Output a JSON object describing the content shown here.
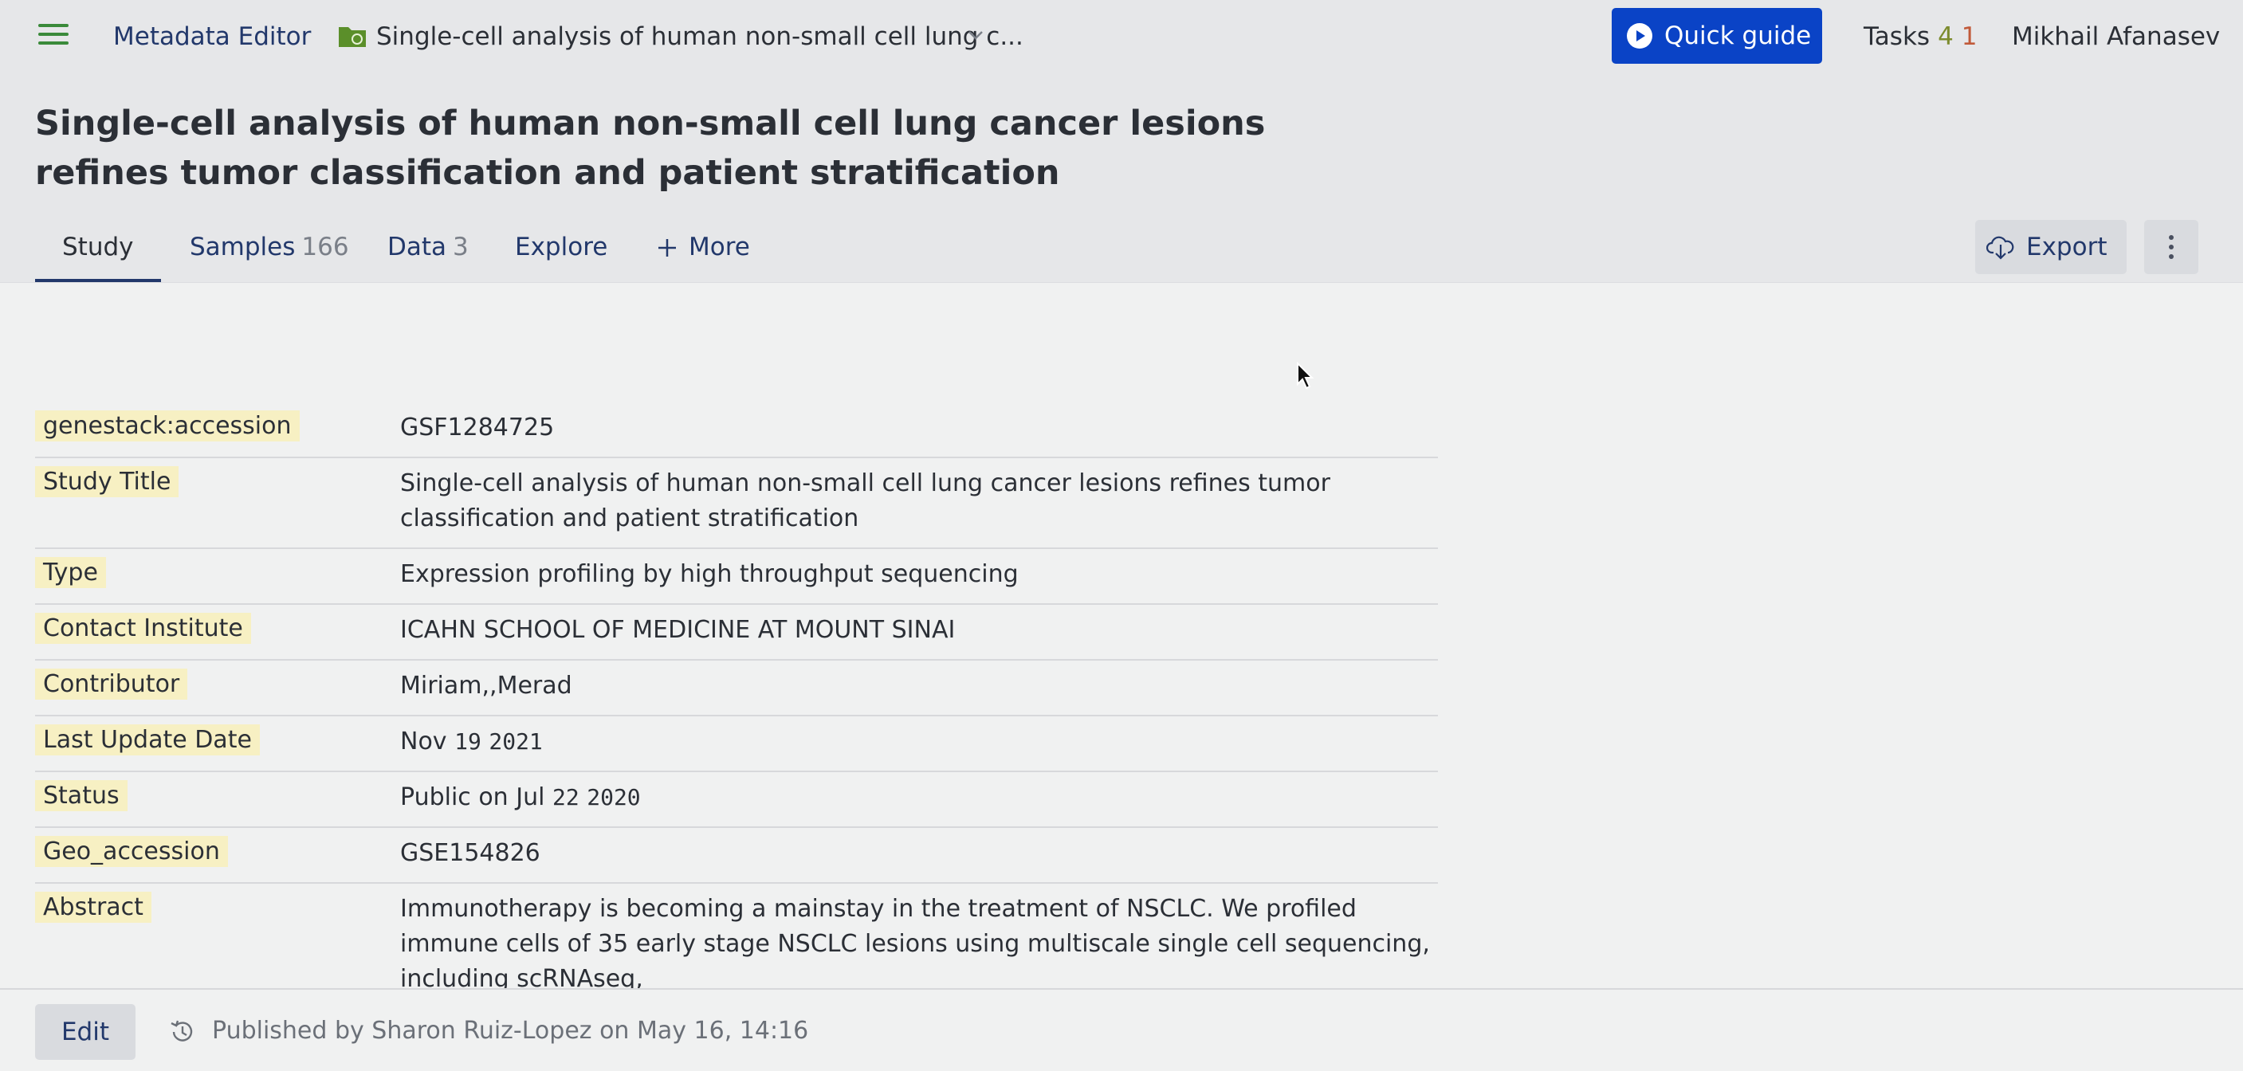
{
  "header": {
    "app_name": "Metadata Editor",
    "breadcrumb_title": "Single-cell analysis of human non-small cell lung c...",
    "quick_guide_label": "Quick guide",
    "tasks_label": "Tasks",
    "tasks_count_a": "4",
    "tasks_count_b": "1",
    "user_name": "Mikhail Afanasev"
  },
  "page": {
    "title": "Single-cell analysis of human non-small cell lung cancer lesions refines tumor classification and patient stratification"
  },
  "tabs": [
    {
      "label": "Study",
      "count": ""
    },
    {
      "label": "Samples",
      "count": "166"
    },
    {
      "label": "Data",
      "count": "3"
    },
    {
      "label": "Explore",
      "count": ""
    },
    {
      "label": "More",
      "count": ""
    }
  ],
  "actions": {
    "export_label": "Export"
  },
  "metadata": [
    {
      "key": "genestack:accession",
      "value": "GSF1284725"
    },
    {
      "key": "Study Title",
      "value": "Single-cell analysis of human non-small cell lung cancer lesions refines tumor classification and patient stratification"
    },
    {
      "key": "Type",
      "value": "Expression profiling by high throughput sequencing"
    },
    {
      "key": "Contact Institute",
      "value": "ICAHN SCHOOL OF MEDICINE AT MOUNT SINAI"
    },
    {
      "key": "Contributor",
      "value": "Miriam,,Merad"
    },
    {
      "key": "Last Update Date",
      "value": "Nov 19 2021"
    },
    {
      "key": "Status",
      "value": "Public on Jul 22 2020"
    },
    {
      "key": "Geo_accession",
      "value": "GSE154826"
    },
    {
      "key": "Abstract",
      "value": "Immunotherapy is becoming a mainstay in the treatment of NSCLC. We profiled immune cells of 35 early stage NSCLC lesions using multiscale single cell sequencing, including scRNAseq,"
    }
  ],
  "footer": {
    "edit_label": "Edit",
    "published_text": "Published by Sharon Ruiz-Lopez on May 16, 14:16"
  },
  "colors": {
    "accent": "#0a43c6",
    "link": "#22386b",
    "key_highlight": "#f7f0c3"
  }
}
